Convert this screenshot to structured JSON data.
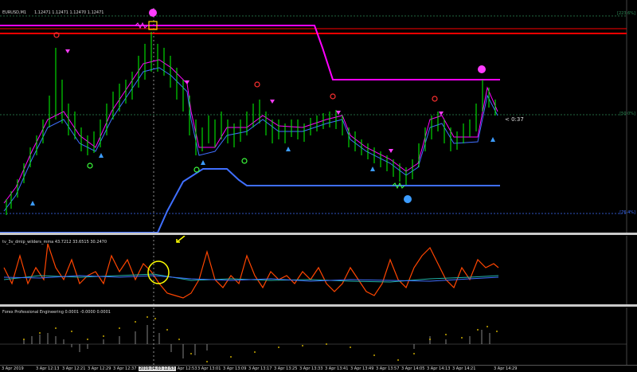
{
  "chart": {
    "symbol": "EURUSD,M1",
    "ohlc": "1.12471 1.12471 1.12470 1.12471",
    "countdown": "< 0:37",
    "levels": {
      "top": "[223.6%]",
      "mid": "[50.0%]",
      "bottom": "[76.4%]"
    }
  },
  "indicator1": {
    "label": "tv_3v_dmip_wilders_mma 43.7212 33.6515 30.2470"
  },
  "indicator2": {
    "label": "Forex Professional Engineering 0.0001 -0.0000 0.0001"
  },
  "time_axis": {
    "labels": [
      "3 Apr 2019",
      "3 Apr 12:13",
      "3 Apr 12:21",
      "3 Apr 12:29",
      "3 Apr 12:37",
      "2019.04.03 12:53",
      "3 Apr 12:53",
      "3 Apr 13:01",
      "3 Apr 13:09",
      "3 Apr 13:17",
      "3 Apr 13:25",
      "3 Apr 13:33",
      "3 Apr 13:41",
      "3 Apr 13:49",
      "3 Apr 13:57",
      "3 Apr 14:05",
      "3 Apr 14:13",
      "3 Apr 14:21",
      "3 Apr 14:29"
    ]
  },
  "colors": {
    "background": "#000000",
    "red_line": "#ff0000",
    "magenta_line": "#ff00ff",
    "blue_line": "#3f6fff",
    "orange_line": "#ff4500",
    "dotted_line": "#ffd700",
    "candle": "#00ff00",
    "signal_yellow": "#ffff00"
  },
  "chart_data": [
    {
      "type": "line",
      "title": "",
      "series": [
        {
          "name": "",
          "values": [
            1.124,
            1.1242,
            1.1245,
            1.1247,
            1.125,
            1.1252,
            1.1251,
            1.1254,
            1.1256,
            1.1254,
            1.125,
            1.1248,
            1.1249,
            1.125,
            1.1252,
            1.1255,
            1.1257,
            1.1256,
            1.125,
            1.1248
          ]
        }
      ]
    }
  ]
}
